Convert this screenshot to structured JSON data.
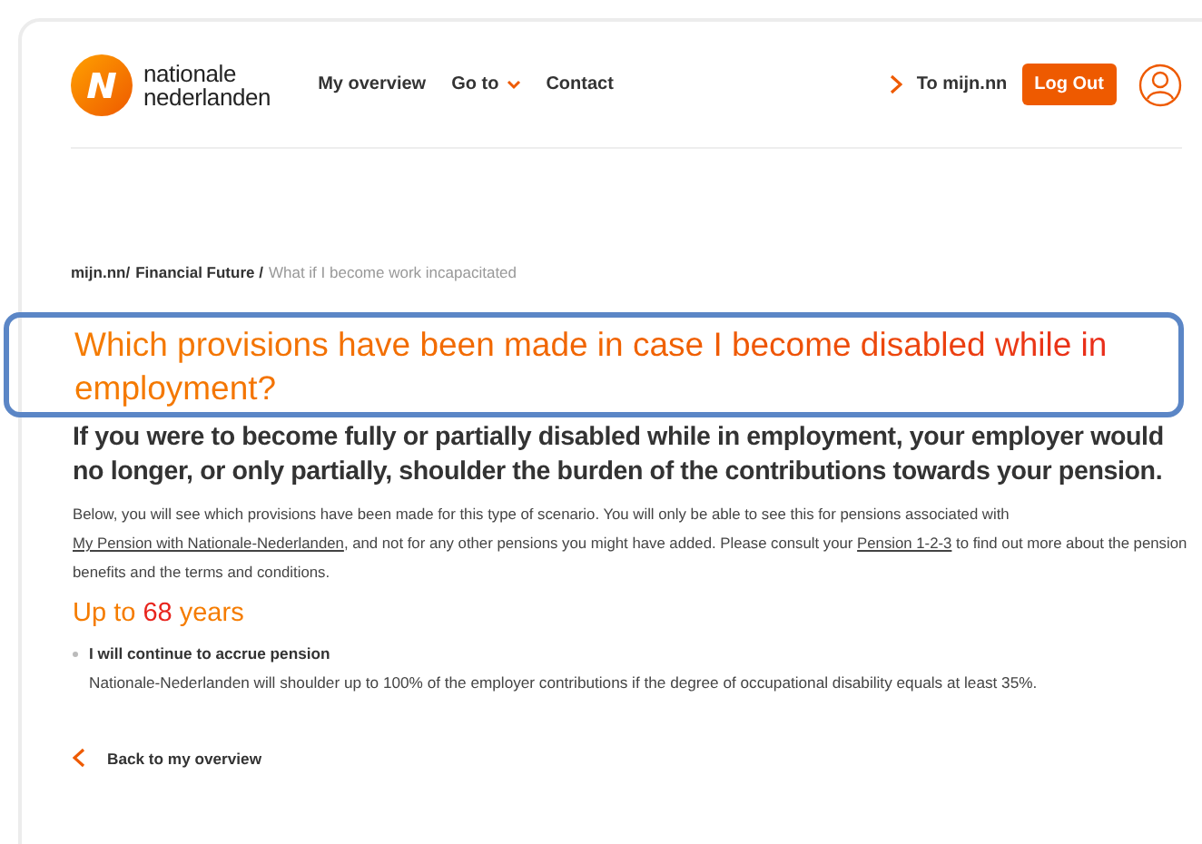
{
  "header": {
    "logo_text": [
      "nationale",
      "nederlanden"
    ],
    "nav": [
      {
        "label": "My overview",
        "kind": "link"
      },
      {
        "label": "Go to",
        "kind": "dropdown"
      },
      {
        "label": "Contact",
        "kind": "link"
      }
    ],
    "portal_link": "To mijn.nn",
    "logout": "Log Out"
  },
  "breadcrumb": [
    {
      "label": "mijn.nn/",
      "current": false
    },
    {
      "label": "Financial Future /",
      "current": false
    },
    {
      "label": "What if I become work incapacitated",
      "current": true
    }
  ],
  "heading": "Which provisions have been made in case I become disabled while in employment?",
  "lead": "If you were to become fully or partially disabled while in employment, your employer would no longer, or only partially, shoulder the burden of the contributions towards your pension.",
  "intro": [
    {
      "kind": "text",
      "text": "Below, you will see which provisions have been made for this type of scenario. You will only be able to see this for pensions associated with "
    },
    {
      "kind": "link",
      "text": "My Pension with Nationale-Nederlanden"
    },
    {
      "kind": "text",
      "text": ", and not for any other pensions you might have added. Please consult your "
    },
    {
      "kind": "link",
      "text": "Pension 1-2-3"
    },
    {
      "kind": "text",
      "text": " to find out more about the pension benefits and the terms and conditions."
    }
  ],
  "section_title": [
    {
      "text": "Up to ",
      "accent": false
    },
    {
      "text": "68",
      "accent": true
    },
    {
      "text": " years",
      "accent": false
    }
  ],
  "provisions": [
    {
      "title": "I will continue to accrue pension",
      "text": "Nationale-Nederlanden will shoulder up to 100% of the employer contributions if the degree of occupational disability equals at least 35%."
    }
  ],
  "back_link": "Back to my overview"
}
